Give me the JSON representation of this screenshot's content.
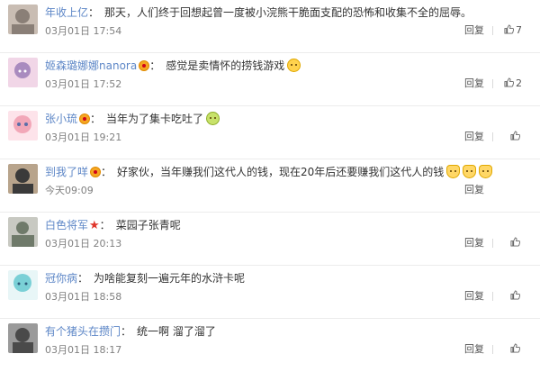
{
  "colors": {
    "username": "#eb7350",
    "username_alt": "#5e87c7",
    "text": "#333333",
    "timestamp": "#808080",
    "divider": "#ececec"
  },
  "comments": [
    {
      "username": "年收上亿",
      "badge": "",
      "separator": "：",
      "text": "那天，人们终于回想起曾一度被小浣熊干脆面支配的恐怖和收集不全的屈辱。",
      "emojis": [],
      "time": "03月01日 17:54",
      "reply_label": "回复",
      "likes": "7",
      "avatar_colors": [
        "#8a7f77",
        "#c9bdb3"
      ]
    },
    {
      "username": "姬森璐娜娜nanora",
      "badge": "member-badge",
      "separator": "：",
      "text": "感觉是卖情怀的捞钱游戏",
      "emojis": [
        "crying-emoji"
      ],
      "time": "03月01日 17:52",
      "reply_label": "回复",
      "likes": "2",
      "avatar_colors": [
        "#a98bbf",
        "#f1d6e7"
      ]
    },
    {
      "username": "张小琉",
      "badge": "member-badge",
      "separator": "：",
      "text": "当年为了集卡吃吐了",
      "emojis": [
        "vomit-emoji"
      ],
      "time": "03月01日 19:21",
      "reply_label": "回复",
      "likes": "",
      "avatar_colors": [
        "#f2a7b8",
        "#fde3ea"
      ]
    },
    {
      "username": "到我了咩",
      "badge": "member-badge",
      "separator": "：",
      "text": "好家伙，当年赚我们这代人的钱，现在20年后还要赚我们这代人的钱",
      "emojis": [
        "cat-emoji",
        "cat-emoji",
        "cat-emoji"
      ],
      "time": "今天09:09",
      "reply_label": "回复",
      "likes": "",
      "avatar_colors": [
        "#3a3a3a",
        "#b8a48c"
      ]
    },
    {
      "username": "白色将军",
      "badge": "star-badge",
      "separator": "：",
      "text": "菜园子张青呢",
      "emojis": [],
      "time": "03月01日 20:13",
      "reply_label": "回复",
      "likes": "",
      "avatar_colors": [
        "#6f7a6a",
        "#c8c9c2"
      ]
    },
    {
      "username": "冠你病",
      "badge": "",
      "separator": "：",
      "text": "为啥能复刻一遍元年的水浒卡呢",
      "emojis": [],
      "time": "03月01日 18:58",
      "reply_label": "回复",
      "likes": "",
      "avatar_colors": [
        "#7ad0d6",
        "#e8f6f7"
      ]
    },
    {
      "username": "有个猪头在攒门",
      "badge": "",
      "separator": "：",
      "text": "统一啊 溜了溜了",
      "emojis": [],
      "time": "03月01日 18:17",
      "reply_label": "回复",
      "likes": "",
      "avatar_colors": [
        "#4a4a4a",
        "#9a9a9a"
      ]
    }
  ]
}
